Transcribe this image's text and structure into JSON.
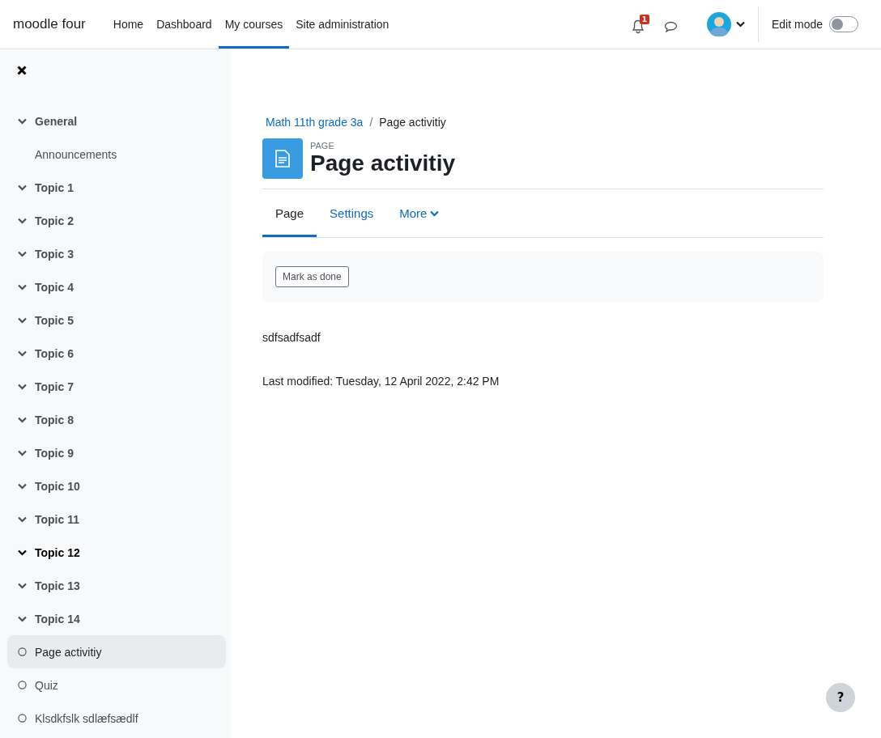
{
  "navbar": {
    "brand": "moodle four",
    "links": [
      {
        "label": "Home",
        "selected": false
      },
      {
        "label": "Dashboard",
        "selected": false
      },
      {
        "label": "My courses",
        "selected": true
      },
      {
        "label": "Site administration",
        "selected": false
      }
    ],
    "notification_count": "1",
    "edit_mode": {
      "label": "Edit mode",
      "on": false
    }
  },
  "sidebar": {
    "items": [
      {
        "kind": "section",
        "label": "General",
        "expanded": true,
        "hovered": false
      },
      {
        "kind": "activity",
        "label": "Announcements",
        "selected": false,
        "icon": false
      },
      {
        "kind": "section",
        "label": "Topic 1",
        "expanded": true,
        "hovered": false
      },
      {
        "kind": "section",
        "label": "Topic 2",
        "expanded": true,
        "hovered": false
      },
      {
        "kind": "section",
        "label": "Topic 3",
        "expanded": true,
        "hovered": false
      },
      {
        "kind": "section",
        "label": "Topic 4",
        "expanded": true,
        "hovered": false
      },
      {
        "kind": "section",
        "label": "Topic 5",
        "expanded": true,
        "hovered": false
      },
      {
        "kind": "section",
        "label": "Topic 6",
        "expanded": true,
        "hovered": false
      },
      {
        "kind": "section",
        "label": "Topic 7",
        "expanded": true,
        "hovered": false
      },
      {
        "kind": "section",
        "label": "Topic 8",
        "expanded": true,
        "hovered": false
      },
      {
        "kind": "section",
        "label": "Topic 9",
        "expanded": true,
        "hovered": false
      },
      {
        "kind": "section",
        "label": "Topic 10",
        "expanded": true,
        "hovered": false
      },
      {
        "kind": "section",
        "label": "Topic 11",
        "expanded": true,
        "hovered": false
      },
      {
        "kind": "section",
        "label": "Topic 12",
        "expanded": true,
        "hovered": true
      },
      {
        "kind": "section",
        "label": "Topic 13",
        "expanded": true,
        "hovered": false
      },
      {
        "kind": "section",
        "label": "Topic 14",
        "expanded": true,
        "hovered": false
      },
      {
        "kind": "activity",
        "label": "Page activitiy",
        "selected": true,
        "icon": true
      },
      {
        "kind": "activity",
        "label": "Quiz",
        "selected": false,
        "icon": true
      },
      {
        "kind": "activity",
        "label": "Klsdkfslk sdlæfsædlf",
        "selected": false,
        "icon": true
      }
    ]
  },
  "breadcrumb": [
    {
      "label": "Math 11th grade 3a",
      "kind": "link"
    },
    {
      "label": "Page activitiy",
      "kind": "current",
      "separator": "/"
    }
  ],
  "header": {
    "type_label": "PAGE",
    "title": "Page activitiy"
  },
  "tabs": [
    {
      "label": "Page",
      "selected": true,
      "dropdown": false
    },
    {
      "label": "Settings",
      "selected": false,
      "dropdown": false
    },
    {
      "label": "More",
      "selected": false,
      "dropdown": true
    }
  ],
  "completion_button": "Mark as done",
  "body_text": "sdfsadfsadf",
  "last_modified": "Last modified: Tuesday, 12 April 2022, 2:42 PM",
  "help_button": "?"
}
